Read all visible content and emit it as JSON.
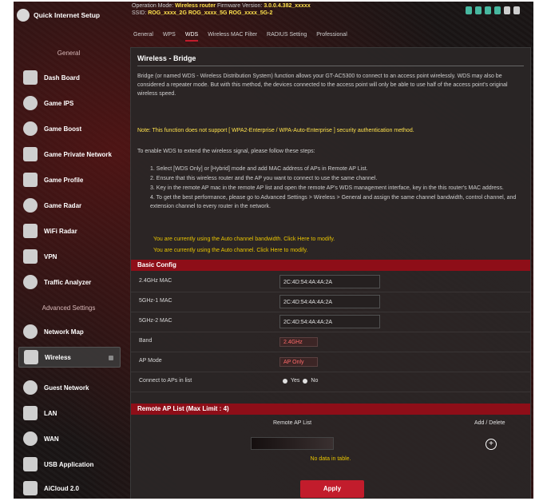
{
  "sidebar": {
    "qis_label": "Quick Internet Setup",
    "general_header": "General",
    "advanced_header": "Advanced Settings",
    "items": [
      {
        "label": "Dash Board"
      },
      {
        "label": "Game IPS"
      },
      {
        "label": "Game Boost"
      },
      {
        "label": "Game Private Network"
      },
      {
        "label": "Game Profile"
      },
      {
        "label": "Game Radar"
      },
      {
        "label": "WiFi Radar"
      },
      {
        "label": "VPN"
      },
      {
        "label": "Traffic Analyzer"
      },
      {
        "label": "Network Map"
      },
      {
        "label": "Wireless"
      },
      {
        "label": "Guest Network"
      },
      {
        "label": "LAN"
      },
      {
        "label": "WAN"
      },
      {
        "label": "USB Application"
      },
      {
        "label": "AiCloud 2.0"
      }
    ]
  },
  "header": {
    "line1_prefix": "Operation Mode:",
    "line1_mode": "Wireless router",
    "line1_fw_prefix": "Firmware Version:",
    "line1_fw": "3.0.0.4.382_xxxxx",
    "line2_prefix": "SSID:",
    "ssid1": "ROG_xxxx_2G",
    "ssid2": "ROG_xxxx_5G",
    "ssid3": "ROG_xxxx_5G-2"
  },
  "tabs": [
    {
      "label": "General"
    },
    {
      "label": "WPS"
    },
    {
      "label": "WDS"
    },
    {
      "label": "Wireless MAC Filter"
    },
    {
      "label": "RADIUS Setting"
    },
    {
      "label": "Professional"
    }
  ],
  "page": {
    "title": "Wireless - Bridge",
    "intro": "Bridge (or named WDS - Wireless Distribution System) function allows your GT-AC5300 to connect to an access point wirelessly. WDS may also be considered a repeater mode. But with this method, the devices connected to the access point will only be able to use half of the access point's original wireless speed.",
    "note": "Note: This function does not support [ WPA2-Enterprise / WPA-Auto-Enterprise ] security authentication method.",
    "steps_intro": "To enable WDS to extend the wireless signal, please follow these steps:",
    "steps": [
      "1. Select [WDS Only] or [Hybrid] mode and add MAC address of APs in Remote AP List.",
      "2. Ensure that this wireless router and the AP you want to connect to use the same channel.",
      "3. Key in the remote AP mac in the remote AP list and open the remote AP's WDS management interface, key in the this router's MAC address.",
      "4. To get the best performance, please go to Advanced Settings > Wireless > General and assign the same channel bandwidth, control channel, and extension channel to every router in the network."
    ],
    "warn1": "You are currently using the Auto channel bandwidth. Click Here to modify.",
    "warn2": "You are currently using the Auto channel. Click Here to modify."
  },
  "basic": {
    "header": "Basic Config",
    "mac_rows": [
      {
        "label": "2.4GHz MAC",
        "value": "2C:4D:54:4A:4A:2A"
      },
      {
        "label": "5GHz-1 MAC",
        "value": "2C:4D:54:4A:4A:2A"
      },
      {
        "label": "5GHz-2 MAC",
        "value": "2C:4D:54:4A:4A:2A"
      }
    ],
    "band_label": "Band",
    "band_value": "2.4GHz",
    "ap_mode_label": "AP Mode",
    "ap_mode_value": "AP Only",
    "connect_label": "Connect to APs in list",
    "connect_yes": "Yes",
    "connect_no": "No"
  },
  "remote": {
    "header": "Remote AP List (Max Limit : 4)",
    "col_list": "Remote AP List",
    "col_action": "Add / Delete",
    "no_data": "No data in table.",
    "add_icon": "plus-circle-icon"
  },
  "apply_label": "Apply",
  "colors": {
    "accent": "#c21c2c",
    "section_bar": "#8e0e18",
    "warning_text": "#e8c400",
    "background": "#1a1515"
  }
}
